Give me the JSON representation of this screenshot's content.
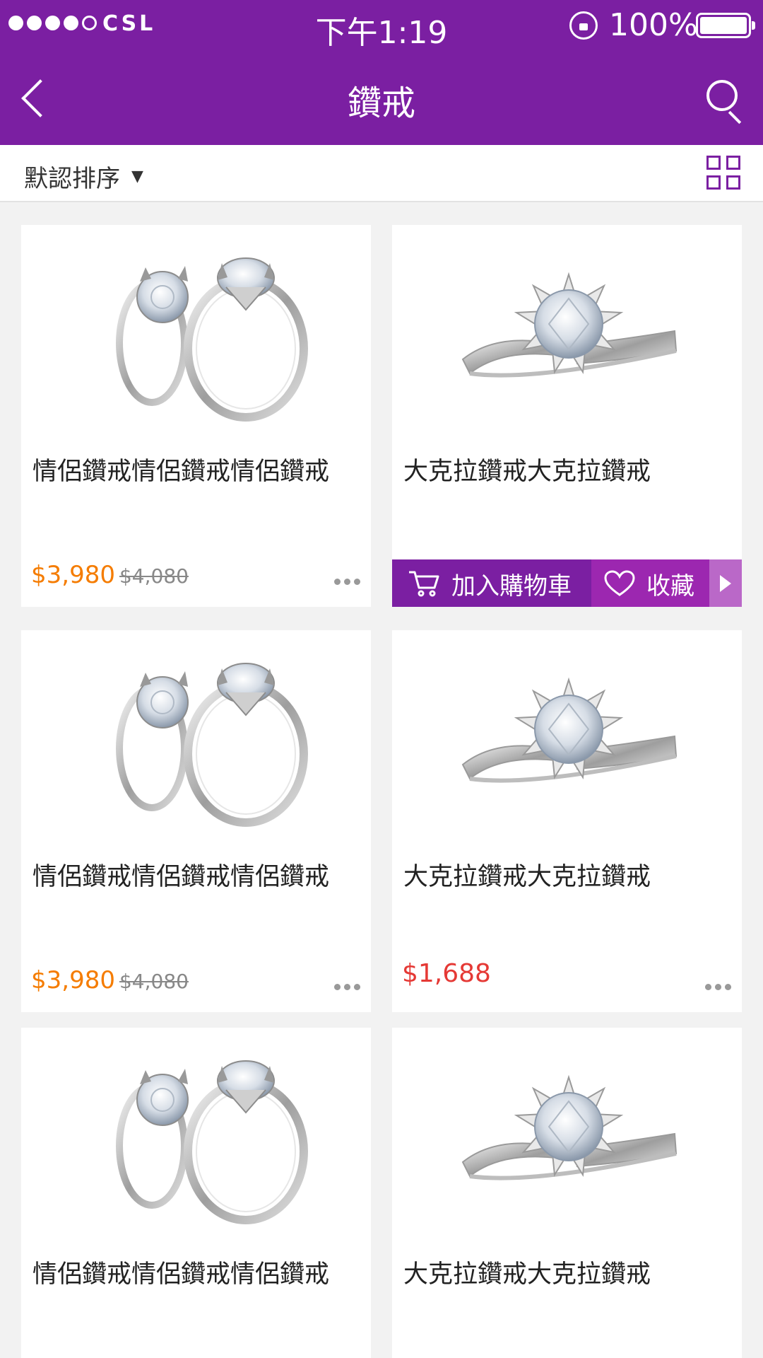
{
  "status_bar": {
    "carrier": "CSL",
    "time": "下午1:19",
    "battery": "100%"
  },
  "nav": {
    "title": "鑽戒"
  },
  "sort": {
    "label": "默認排序",
    "caret": "▼"
  },
  "action_bar": {
    "add_cart": "加入購物車",
    "favorite": "收藏"
  },
  "products": [
    {
      "name": "情侶鑽戒情侶鑽戒情侶鑽戒",
      "price": "$3,980",
      "original_price": "$4,080",
      "image": "couple-rings"
    },
    {
      "name": "大克拉鑽戒大克拉鑽戒",
      "image": "solitaire-ring"
    },
    {
      "name": "情侶鑽戒情侶鑽戒情侶鑽戒",
      "price": "$3,980",
      "original_price": "$4,080",
      "image": "couple-rings"
    },
    {
      "name": "大克拉鑽戒大克拉鑽戒",
      "price": "$1,688",
      "image": "solitaire-ring"
    },
    {
      "name": "情侶鑽戒情侶鑽戒情侶鑽戒",
      "image": "couple-rings"
    },
    {
      "name": "大克拉鑽戒大克拉鑽戒",
      "image": "solitaire-ring"
    }
  ],
  "colors": {
    "brand": "#7b1fa2",
    "sale_price": "#f57c00",
    "discount_price": "#e53935"
  },
  "icons": [
    "back-arrow-icon",
    "search-icon",
    "grid-view-icon",
    "cart-icon",
    "heart-icon",
    "more-icon",
    "play-arrow-icon",
    "rotation-lock-icon",
    "battery-icon"
  ]
}
